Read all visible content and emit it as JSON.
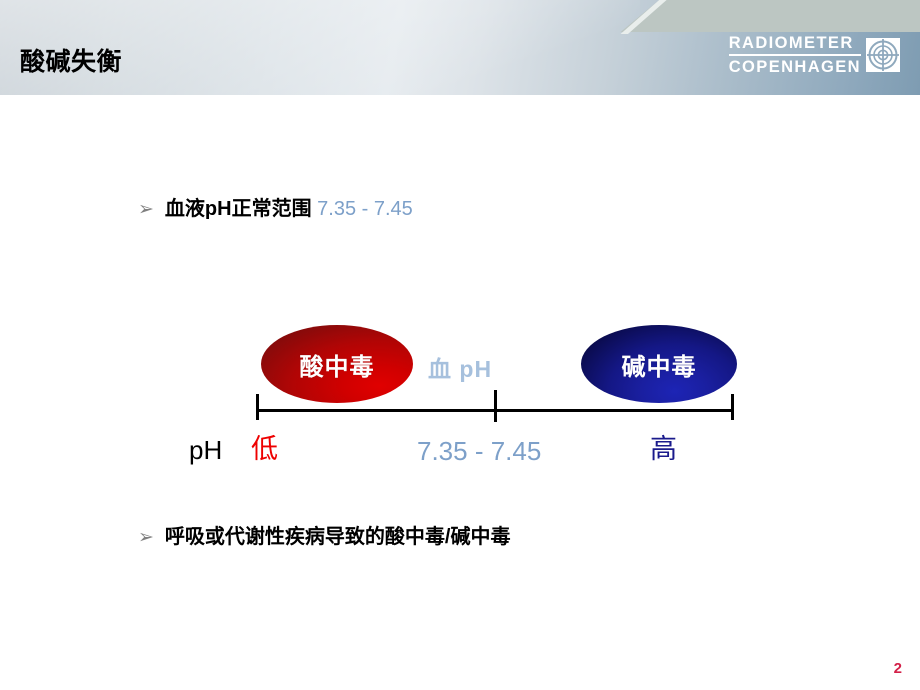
{
  "slide": {
    "title": "酸碱失衡",
    "page_number": "2"
  },
  "logo": {
    "line1": "RADIOMETER",
    "line2": "COPENHAGEN",
    "mark_name": "radiometer-circle-emblem"
  },
  "bullets": [
    {
      "marker": "➢",
      "text": "血液pH正常范围 ",
      "value": "7.35 - 7.45"
    },
    {
      "marker": "➢",
      "text": "呼吸或代谢性疾病导致的酸中毒/碱中毒",
      "value": ""
    }
  ],
  "diagram": {
    "caption": "血 pH",
    "acidosis_label": "酸中毒",
    "alkalosis_label": "碱中毒",
    "axis_title": "pH",
    "axis_low": "低",
    "axis_mid": "7.35 - 7.45",
    "axis_high": "高"
  },
  "colors": {
    "acidosis_red": "#b10505",
    "alkalosis_blue": "#141785",
    "range_blue": "#7da0c9",
    "caption_blue": "#a6c0dd",
    "low_red": "#ee0000",
    "high_blue": "#1a1a8c",
    "page_number_red": "#d32048",
    "header_steel": "#8fa9bd",
    "header_wedge_grey": "#bcc6c2"
  }
}
